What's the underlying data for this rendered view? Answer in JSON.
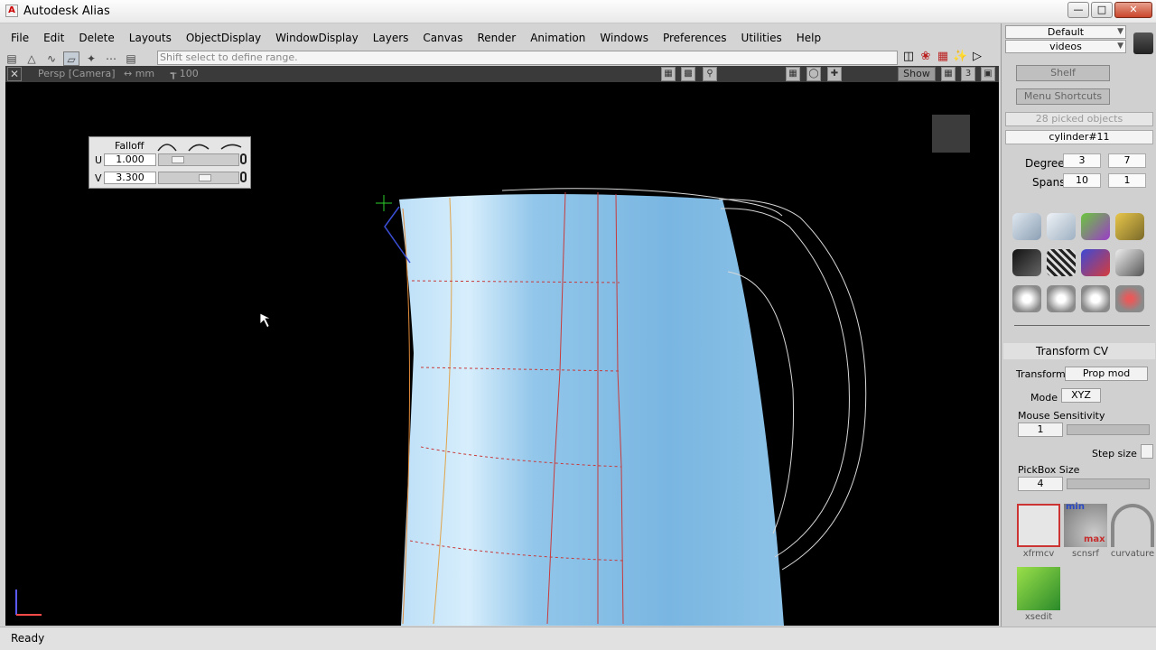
{
  "window": {
    "title": "Autodesk Alias",
    "app_icon": "A"
  },
  "menu": [
    "File",
    "Edit",
    "Delete",
    "Layouts",
    "ObjectDisplay",
    "WindowDisplay",
    "Layers",
    "Canvas",
    "Render",
    "Animation",
    "Windows",
    "Preferences",
    "Utilities",
    "Help"
  ],
  "toolbar": {
    "prompt": "Shift select to define range."
  },
  "viewport": {
    "camera": "Persp [Camera]",
    "units": "↔ mm",
    "grid": "┱ 100",
    "show_label": "Show",
    "layout_num": "3"
  },
  "falloff": {
    "label": "Falloff",
    "u_label": "U",
    "u_value": "1.000",
    "v_label": "V",
    "v_value": "3.300"
  },
  "side": {
    "preset": "Default",
    "shelf_set": "videos",
    "shelf_tab": "Shelf",
    "shortcuts_tab": "Menu Shortcuts",
    "picked": "28 picked objects",
    "object": "cylinder#11",
    "degree_label": "Degree",
    "degree_u": "3",
    "degree_v": "7",
    "spans_label": "Spans",
    "spans_u": "10",
    "spans_v": "1",
    "transform_cv": {
      "title": "Transform CV",
      "transform_label": "Transform",
      "transform_value": "Prop mod",
      "mode_label": "Mode",
      "mode_value": "XYZ",
      "sensitivity_label": "Mouse Sensitivity",
      "sensitivity_value": "1",
      "step_label": "Step size",
      "pickbox_label": "PickBox Size",
      "pickbox_value": "4"
    },
    "tools": [
      {
        "name": "xfrmcv"
      },
      {
        "name": "scnsrf"
      },
      {
        "name": "curvature"
      },
      {
        "name": "xsedit"
      }
    ],
    "scnsrf_min": "min",
    "scnsrf_max": "max"
  },
  "status": "Ready"
}
